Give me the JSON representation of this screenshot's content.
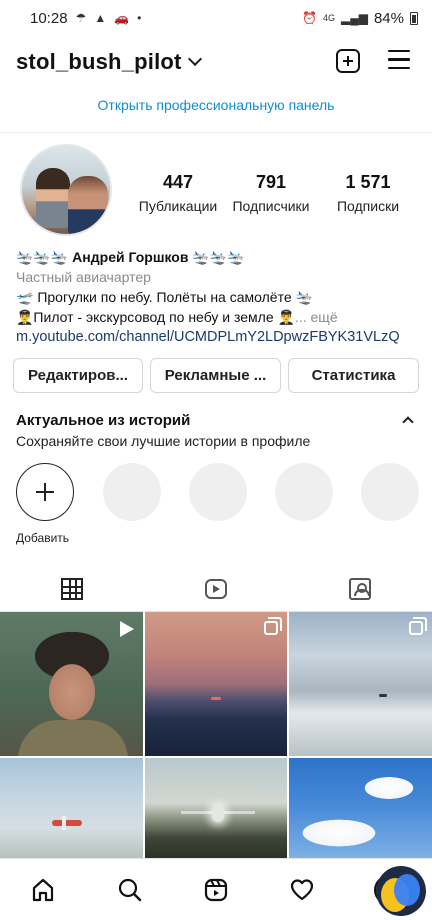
{
  "status_bar": {
    "time": "10:28",
    "network": "4G",
    "battery": "84%"
  },
  "header": {
    "username": "stol_bush_pilot"
  },
  "pro_panel": {
    "label": "Открыть профессиональную панель"
  },
  "profile": {
    "stats": [
      {
        "value": "447",
        "label": "Публикации"
      },
      {
        "value": "791",
        "label": "Подписчики"
      },
      {
        "value": "1 571",
        "label": "Подписки"
      }
    ]
  },
  "bio": {
    "name": "🛬🛬🛬 Андрей Горшков 🛬🛬🛬",
    "category": "Частный авиачартер",
    "line1": "🛫 Прогулки по небу. Полёты на самолёте 🛬",
    "line2": "👨‍✈️Пилот - экскурсовод по небу и земле 👨‍✈️",
    "more": "... ещё",
    "link": "m.youtube.com/channel/UCMDPLmY2LDpwzFBYK31VLzQ"
  },
  "buttons": {
    "edit": "Редактиров...",
    "ads": "Рекламные ...",
    "stats": "Статистика"
  },
  "highlights": {
    "title": "Актуальное из историй",
    "subtitle": "Сохраняйте свои лучшие истории в профиле",
    "add_label": "Добавить"
  },
  "tabs": [
    {
      "icon": "grid-icon",
      "active": true
    },
    {
      "icon": "reels-icon",
      "active": false
    },
    {
      "icon": "tagged-icon",
      "active": false
    }
  ],
  "posts": [
    {
      "type": "reel"
    },
    {
      "type": "carousel"
    },
    {
      "type": "carousel"
    },
    {
      "type": "photo"
    },
    {
      "type": "photo"
    },
    {
      "type": "photo"
    }
  ],
  "bottom_nav": [
    "home-icon",
    "search-icon",
    "reels-icon",
    "heart-icon",
    "profile-avatar"
  ],
  "colors": {
    "link_blue": "#0c8fd3",
    "url_blue": "#1b3a6d",
    "muted_gray": "#8a8a8a"
  }
}
